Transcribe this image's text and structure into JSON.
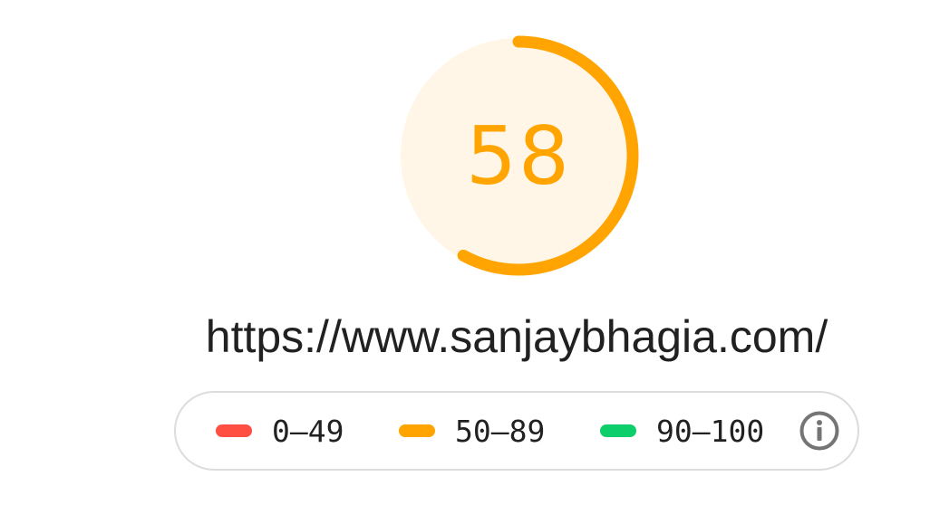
{
  "gauge": {
    "score": "58",
    "progress_fraction": 0.58,
    "color": "#ffa400",
    "fill_color": "#fff6e7"
  },
  "page": {
    "url": "https://www.sanjaybhagia.com/"
  },
  "legend": {
    "items": [
      {
        "label": "0–49",
        "color": "#ff4e42"
      },
      {
        "label": "50–89",
        "color": "#ffa400"
      },
      {
        "label": "90–100",
        "color": "#0cce6b"
      }
    ],
    "info_icon": "info-icon"
  }
}
